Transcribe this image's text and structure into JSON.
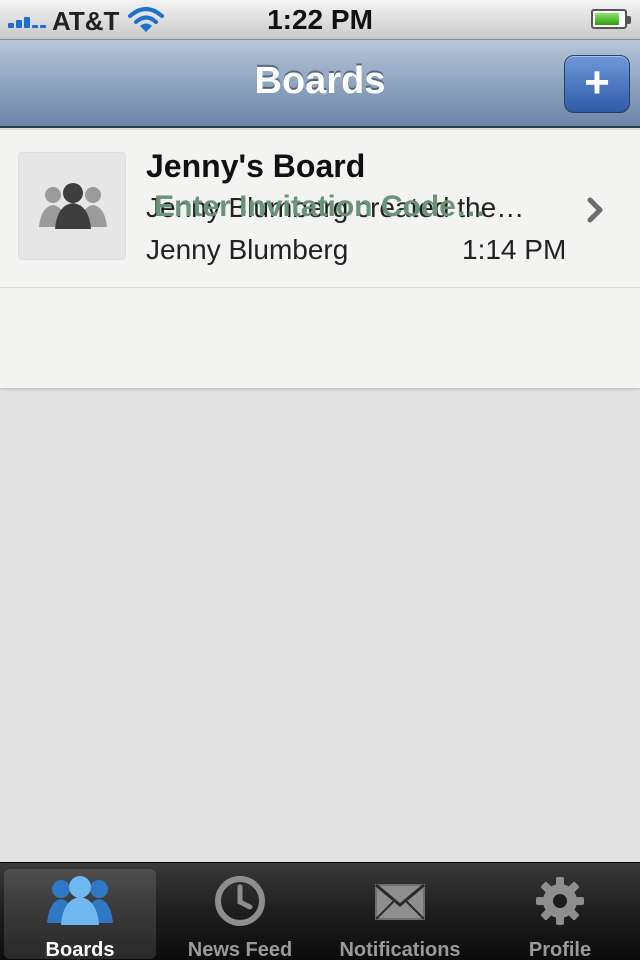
{
  "status_bar": {
    "carrier": "AT&T",
    "time": "1:22 PM"
  },
  "nav": {
    "title": "Boards",
    "add_label": "+"
  },
  "boards": [
    {
      "title": "Jenny's Board",
      "description": "Jenny Blumberg created the…",
      "author": "Jenny Blumberg",
      "time": "1:14 PM"
    }
  ],
  "invite": {
    "label": "Enter Invitation Code…"
  },
  "tabs": [
    {
      "label": "Boards",
      "icon": "people-icon",
      "selected": true
    },
    {
      "label": "News Feed",
      "icon": "clock-icon",
      "selected": false
    },
    {
      "label": "Notifications",
      "icon": "envelope-icon",
      "selected": false
    },
    {
      "label": "Profile",
      "icon": "gear-icon",
      "selected": false
    }
  ],
  "colors": {
    "nav_accent": "#6d87a8",
    "invite_link": "#6a9479",
    "tab_selected_icon": "#4a9ee6"
  }
}
